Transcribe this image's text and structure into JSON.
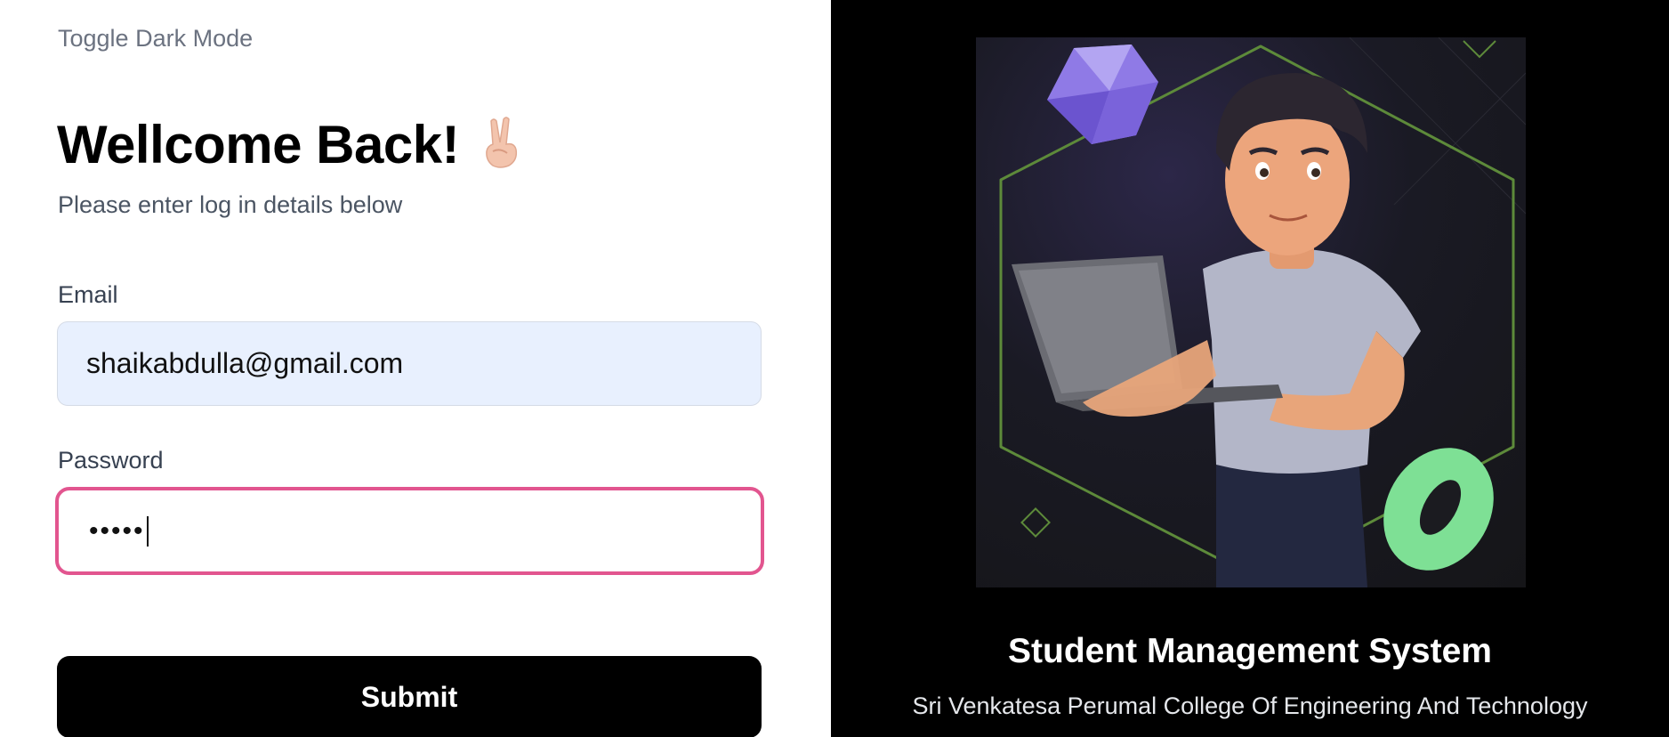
{
  "toggle_label": "Toggle Dark Mode",
  "login": {
    "heading": "Wellcome Back!",
    "subtitle": "Please enter log in details below",
    "email_label": "Email",
    "email_value": "shaikabdulla@gmail.com",
    "password_label": "Password",
    "password_value_masked": "•••••",
    "submit_label": "Submit"
  },
  "hero": {
    "title": "Student Management System",
    "college": "Sri Venkatesa Perumal College Of Engineering And Technology"
  },
  "colors": {
    "focus_border": "#e2558f",
    "email_bg": "#e8f0fe",
    "submit_bg": "#000000",
    "panel_dark": "#000000"
  },
  "icons": {
    "wave_hand": "victory-hand-icon"
  }
}
